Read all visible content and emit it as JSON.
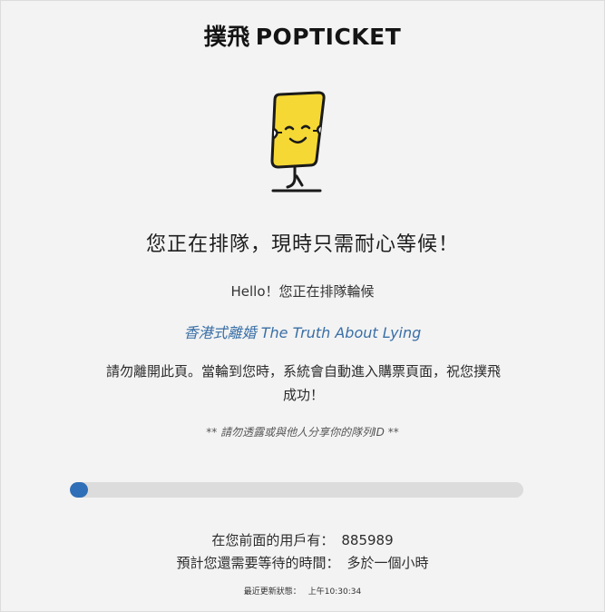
{
  "brand": {
    "name_cn": "撲飛",
    "name_en": "POPTICKET"
  },
  "mascot": {
    "icon": "ticket-mascot-icon",
    "body_color": "#f5d834",
    "outline_color": "#1a1a1a"
  },
  "queue": {
    "headline": "您正在排隊，現時只需耐心等候！",
    "hello": "Hello！您正在排隊輪候",
    "event_title": "香港式離婚 The Truth About Lying",
    "notice": "請勿離開此頁。當輪到您時，系統會自動進入購票頁面，祝您撲飛成功！",
    "privacy_note": "** 請勿透露或與他人分享你的隊列ID **",
    "progress_fraction": 0.03,
    "users_ahead_label": "在您前面的用戶有：",
    "users_ahead_value": "885989",
    "wait_label": "預計您還需要等待的時間：",
    "wait_value": "多於一個小時",
    "last_updated_label": "最近更新狀態：",
    "last_updated_value": "上午10:30:34"
  },
  "colors": {
    "accent": "#2f6fb7",
    "event_link": "#3a6fa6",
    "track": "#dcdcdc",
    "background": "#f3f3f3"
  }
}
